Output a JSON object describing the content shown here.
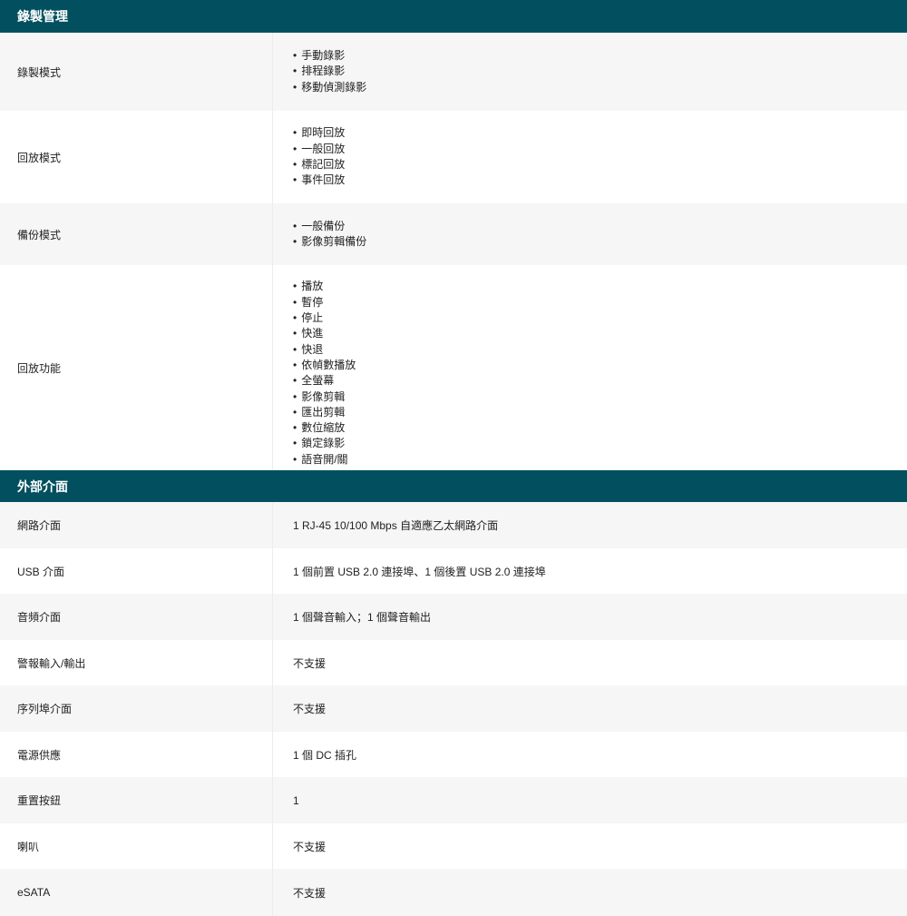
{
  "recording_section": {
    "title": "錄製管理",
    "rows": [
      {
        "label": "錄製模式",
        "items": [
          "手動錄影",
          "排程錄影",
          "移動偵測錄影"
        ]
      },
      {
        "label": "回放模式",
        "items": [
          "即時回放",
          "一般回放",
          "標記回放",
          "事件回放"
        ]
      },
      {
        "label": "備份模式",
        "items": [
          "一般備份",
          "影像剪輯備份"
        ]
      },
      {
        "label": "回放功能",
        "items": [
          "播放",
          "暫停",
          "停止",
          "快進",
          "快退",
          "依幀數播放",
          "全螢幕",
          "影像剪輯",
          "匯出剪輯",
          "數位縮放",
          "鎖定錄影",
          "語音開/關"
        ]
      }
    ]
  },
  "interface_section": {
    "title": "外部介面",
    "rows": [
      {
        "label": "網路介面",
        "value": "1 RJ-45 10/100 Mbps 自適應乙太網路介面"
      },
      {
        "label": "USB 介面",
        "value": "1 個前置 USB 2.0 連接埠、1 個後置 USB 2.0 連接埠"
      },
      {
        "label": "音頻介面",
        "value": "1 個聲音輸入；1 個聲音輸出"
      },
      {
        "label": "警報輸入/輸出",
        "value": "不支援"
      },
      {
        "label": "序列埠介面",
        "value": "不支援"
      },
      {
        "label": "電源供應",
        "value": "1 個 DC 插孔"
      },
      {
        "label": "重置按鈕",
        "value": "1"
      },
      {
        "label": "喇叭",
        "value": "不支援"
      },
      {
        "label": "eSATA",
        "value": "不支援"
      }
    ]
  },
  "colors": {
    "header_bg": "#02505f",
    "row_shade": "#f6f6f6"
  }
}
